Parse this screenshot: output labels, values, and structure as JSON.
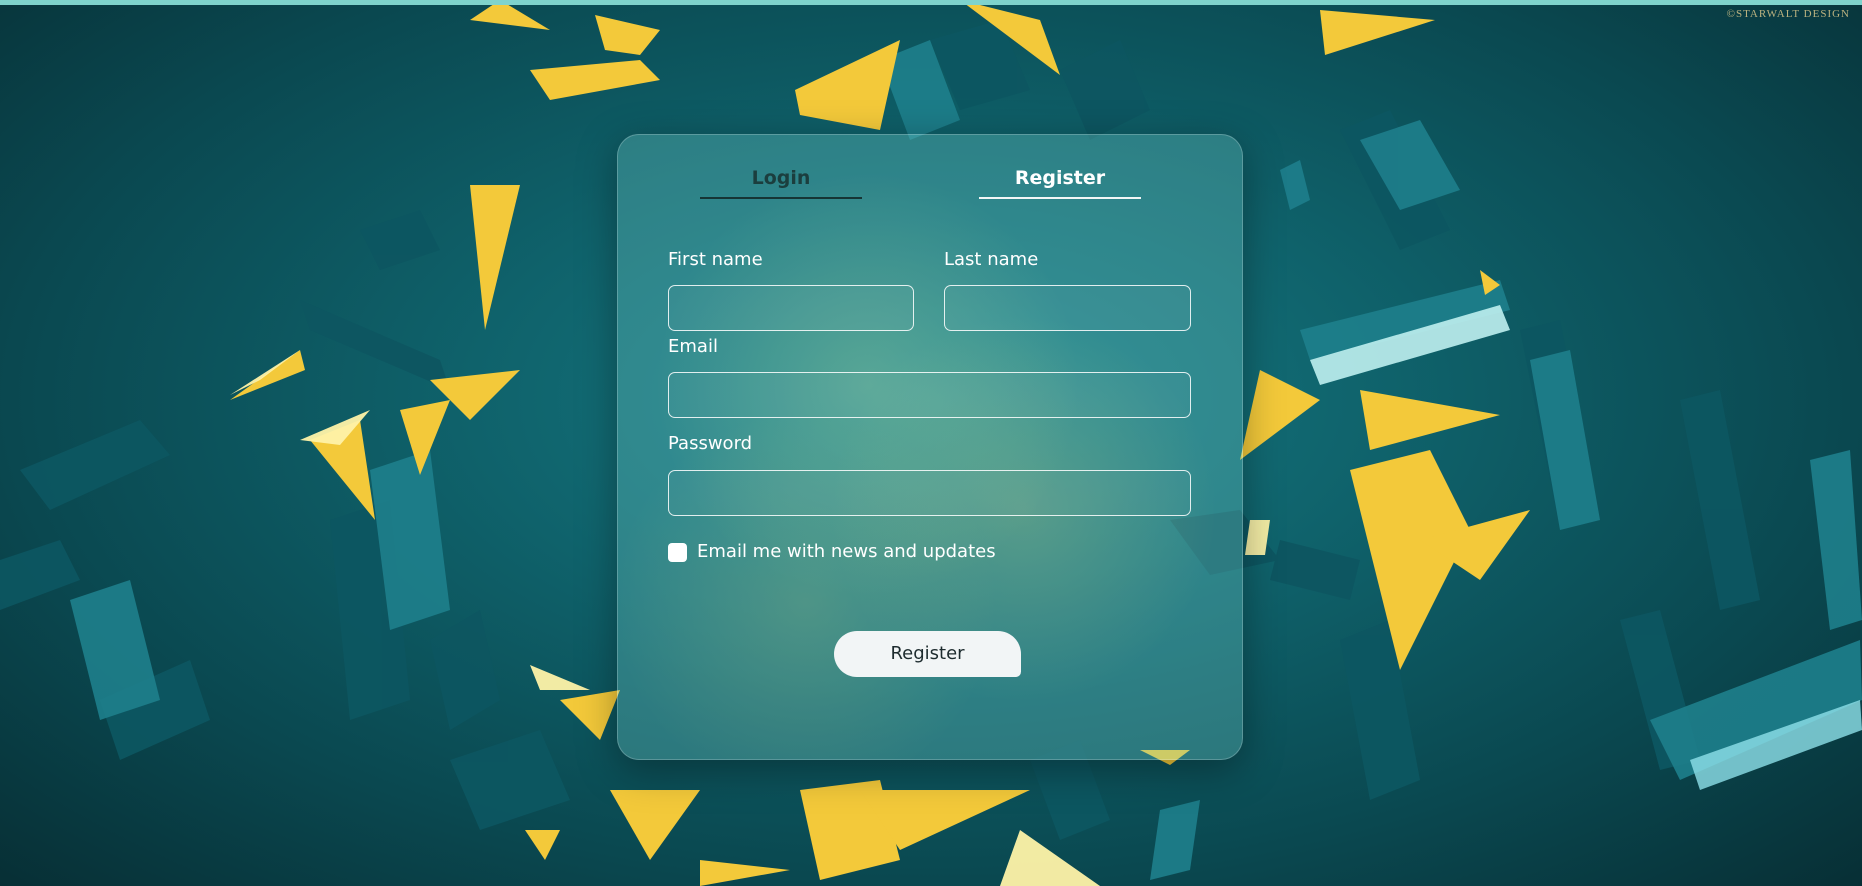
{
  "watermark": "©STARWALT DESIGN",
  "tabs": {
    "login": "Login",
    "register": "Register"
  },
  "form": {
    "first_name_label": "First name",
    "last_name_label": "Last name",
    "email_label": "Email",
    "password_label": "Password",
    "first_name_value": "",
    "last_name_value": "",
    "email_value": "",
    "password_value": "",
    "newsletter_label": "Email me with news and updates",
    "newsletter_checked": false,
    "submit_label": "Register"
  },
  "colors": {
    "background": "#0b4a52",
    "accent_yellow": "#f3c93a",
    "crystal_teal": "#1e7f8c",
    "button_bg": "#f2f5f6"
  }
}
